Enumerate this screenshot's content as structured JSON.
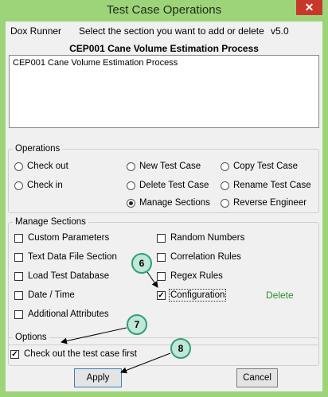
{
  "window": {
    "title": "Test Case Operations",
    "close_glyph": "✕"
  },
  "header": {
    "app_name": "Dox Runner",
    "instruction": "Select the section you want to add or delete",
    "version": "v5.0",
    "process_title": "CEP001 Cane Volume Estimation Process"
  },
  "textbox": {
    "content": "CEP001 Cane Volume Estimation Process"
  },
  "operations": {
    "legend": "Operations",
    "items": [
      {
        "label": "Check out",
        "selected": false
      },
      {
        "label": "Check in",
        "selected": false
      },
      {
        "label": "New Test Case",
        "selected": false
      },
      {
        "label": "Delete Test Case",
        "selected": false
      },
      {
        "label": "Manage Sections",
        "selected": true
      },
      {
        "label": "Copy Test Case",
        "selected": false
      },
      {
        "label": "Rename Test Case",
        "selected": false
      },
      {
        "label": "Reverse Engineer",
        "selected": false
      }
    ]
  },
  "manage_sections": {
    "legend": "Manage Sections",
    "items": [
      {
        "label": "Custom Parameters",
        "checked": false
      },
      {
        "label": "Text Data File Section",
        "checked": false
      },
      {
        "label": "Load Test Database",
        "checked": false
      },
      {
        "label": "Date / Time",
        "checked": false
      },
      {
        "label": "Additional Attributes",
        "checked": false
      },
      {
        "label": "Random Numbers",
        "checked": false
      },
      {
        "label": "Correlation Rules",
        "checked": false
      },
      {
        "label": "Regex Rules",
        "checked": false
      },
      {
        "label": "Configuration",
        "checked": true
      }
    ],
    "action_label": "Delete",
    "action_color": "#2e8b2e"
  },
  "options": {
    "legend": "Options",
    "checkout_first": {
      "label": "Check out the test case first",
      "checked": true
    }
  },
  "buttons": {
    "apply": "Apply",
    "cancel": "Cancel"
  },
  "callouts": [
    "6",
    "7",
    "8"
  ],
  "colors": {
    "title_bar": "#9dd47a",
    "callout_fill": "#bfe8d8",
    "callout_border": "#2f9f78",
    "close": "#c7382a"
  }
}
